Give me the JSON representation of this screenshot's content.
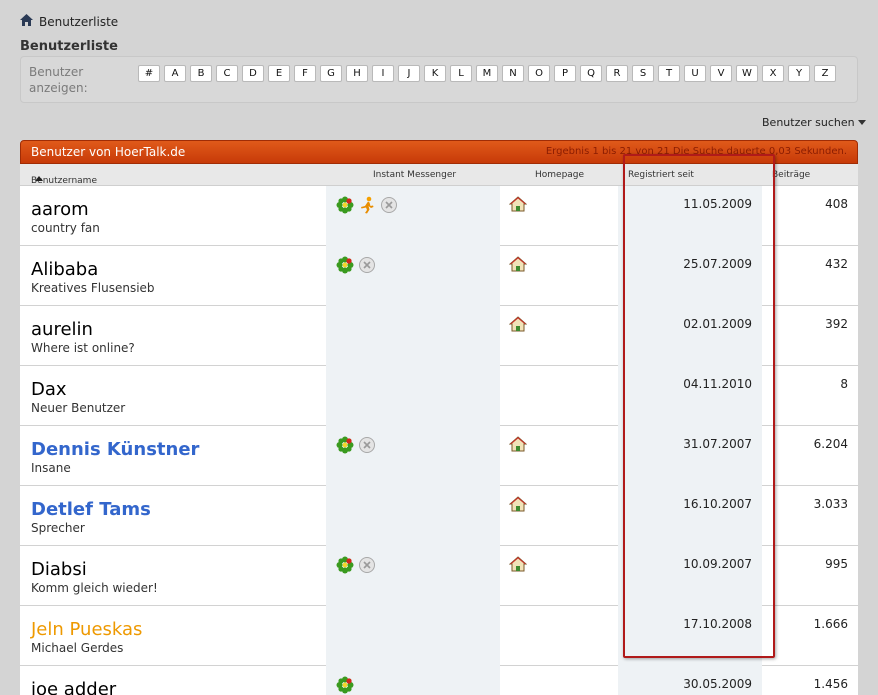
{
  "breadcrumb": {
    "label": "Benutzerliste"
  },
  "page_title": "Benutzerliste",
  "filter": {
    "label": "Benutzer anzeigen:",
    "letters": [
      "#",
      "A",
      "B",
      "C",
      "D",
      "E",
      "F",
      "G",
      "H",
      "I",
      "J",
      "K",
      "L",
      "M",
      "N",
      "O",
      "P",
      "Q",
      "R",
      "S",
      "T",
      "U",
      "V",
      "W",
      "X",
      "Y",
      "Z"
    ]
  },
  "search_label": "Benutzer suchen",
  "panel": {
    "title": "Benutzer von HoerTalk.de",
    "result_info": "Ergebnis 1 bis 21 von 21 Die Suche dauerte 0,03 Sekunden."
  },
  "columns": {
    "username": "Benutzername",
    "im": "Instant Messenger",
    "homepage": "Homepage",
    "registered": "Registriert seit",
    "posts": "Beiträge"
  },
  "colors": {
    "header": "#d94f14",
    "admin": "#3366cc",
    "mod": "#ee9900",
    "highlight": "#b01a1a"
  },
  "users": [
    {
      "name": "aarom",
      "title": "country fan",
      "color": "#000000",
      "bold": false,
      "icons": [
        "icq-icon",
        "aim-icon",
        "msn-icon"
      ],
      "homepage": true,
      "registered": "11.05.2009",
      "posts": "408"
    },
    {
      "name": "Alibaba",
      "title": "Kreatives Flusensieb",
      "color": "#000000",
      "bold": false,
      "icons": [
        "icq-icon",
        "msn-icon"
      ],
      "homepage": true,
      "registered": "25.07.2009",
      "posts": "432"
    },
    {
      "name": "aurelin",
      "title": "Where ist online?",
      "color": "#000000",
      "bold": false,
      "icons": [],
      "homepage": true,
      "registered": "02.01.2009",
      "posts": "392"
    },
    {
      "name": "Dax",
      "title": "Neuer Benutzer",
      "color": "#000000",
      "bold": false,
      "icons": [],
      "homepage": false,
      "registered": "04.11.2010",
      "posts": "8"
    },
    {
      "name": "Dennis Künstner",
      "title": "Insane",
      "color": "#3366cc",
      "bold": true,
      "icons": [
        "icq-icon",
        "msn-icon"
      ],
      "homepage": true,
      "registered": "31.07.2007",
      "posts": "6.204"
    },
    {
      "name": "Detlef Tams",
      "title": "Sprecher",
      "color": "#3366cc",
      "bold": true,
      "icons": [],
      "homepage": true,
      "registered": "16.10.2007",
      "posts": "3.033"
    },
    {
      "name": "Diabsi",
      "title": "Komm gleich wieder!",
      "color": "#000000",
      "bold": false,
      "icons": [
        "icq-icon",
        "msn-icon"
      ],
      "homepage": true,
      "registered": "10.09.2007",
      "posts": "995"
    },
    {
      "name": "Jeln Pueskas",
      "title": "Michael Gerdes",
      "color": "#ee9900",
      "bold": false,
      "icons": [],
      "homepage": false,
      "registered": "17.10.2008",
      "posts": "1.666"
    },
    {
      "name": "joe adder",
      "title": "",
      "color": "#000000",
      "bold": false,
      "icons": [
        "icq-icon"
      ],
      "homepage": false,
      "registered": "30.05.2009",
      "posts": "1.456"
    }
  ]
}
